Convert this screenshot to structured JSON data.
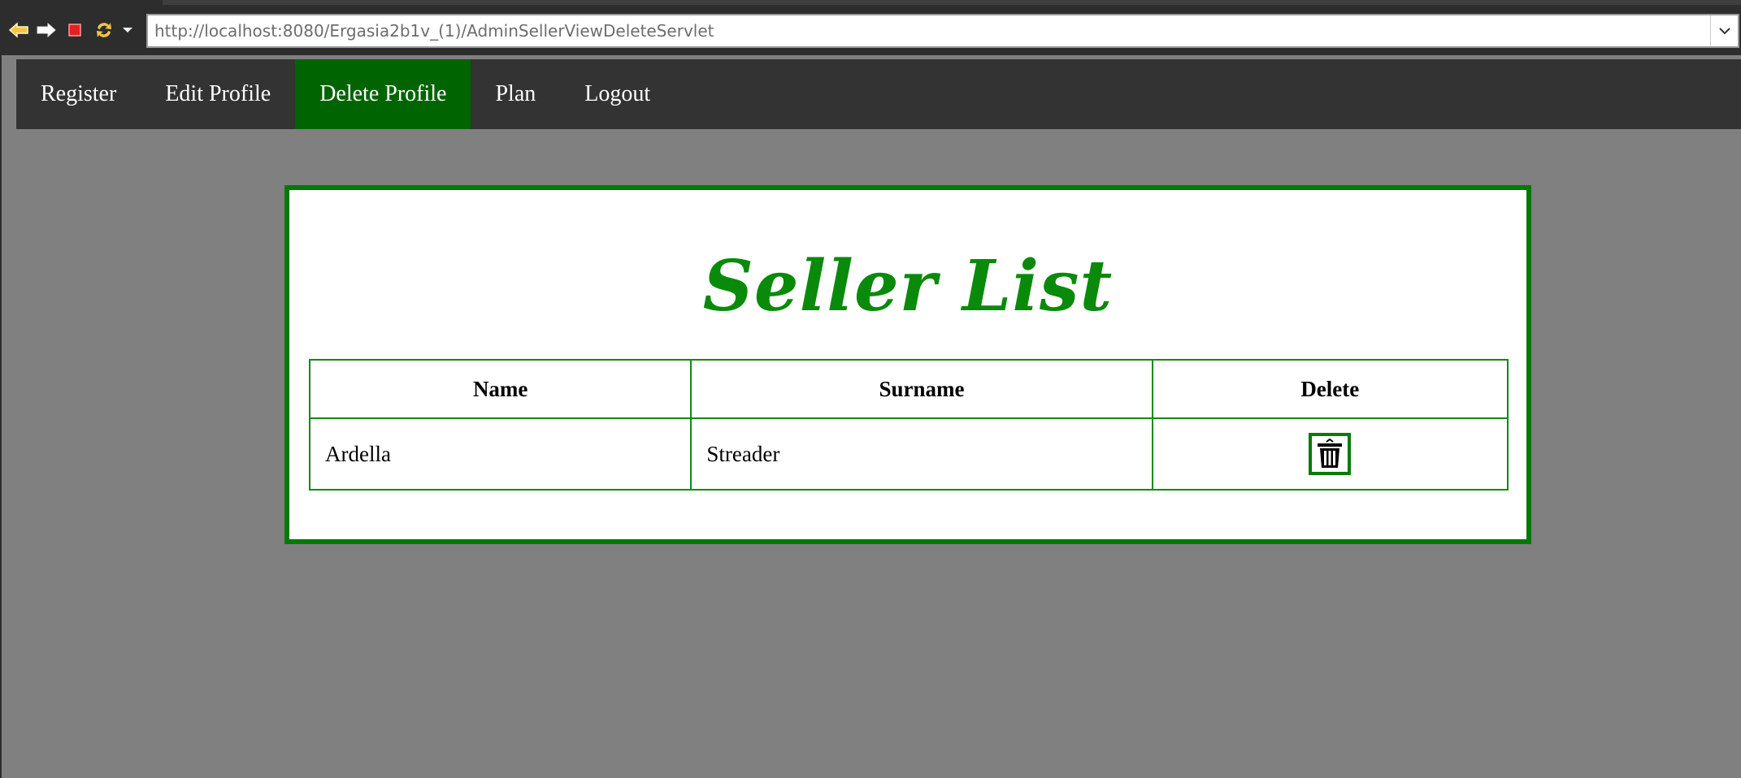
{
  "browser": {
    "url": "http://localhost:8080/Ergasia2b1v_(1)/AdminSellerViewDeleteServlet",
    "icons": [
      "back-arrow-icon",
      "forward-arrow-icon",
      "stop-icon",
      "refresh-icon",
      "dropdown-caret-icon"
    ]
  },
  "nav": {
    "items": [
      {
        "label": "Register"
      },
      {
        "label": "Edit Profile"
      },
      {
        "label": "Delete Profile",
        "active": true
      },
      {
        "label": "Plan"
      },
      {
        "label": "Logout"
      }
    ]
  },
  "main": {
    "title": "Seller List",
    "table": {
      "headers": [
        "Name",
        "Surname",
        "Delete"
      ],
      "rows": [
        {
          "name": "Ardella",
          "surname": "Streader",
          "delete_icon": "trash-icon"
        }
      ]
    }
  },
  "colors": {
    "nav_bg": "#333333",
    "nav_active": "#006400",
    "page_bg": "#808080",
    "accent_green": "#007a00"
  }
}
